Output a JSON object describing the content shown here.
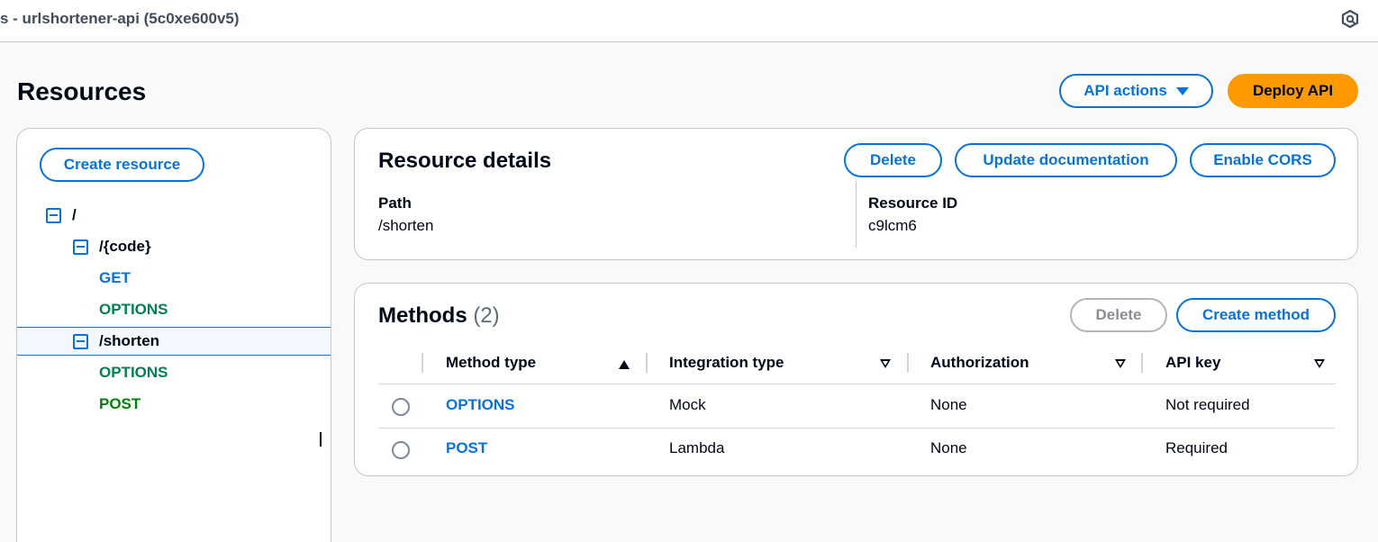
{
  "topbar": {
    "title": "s - urlshortener-api (5c0xe600v5)",
    "icon": "cloudshell-icon"
  },
  "page": {
    "title": "Resources",
    "api_actions_label": "API actions",
    "deploy_api_label": "Deploy API"
  },
  "tree": {
    "create_resource_label": "Create resource",
    "items": [
      {
        "label": "/",
        "kind": "resource"
      },
      {
        "label": "/{code}",
        "kind": "resource"
      },
      {
        "label": "GET",
        "kind": "method"
      },
      {
        "label": "OPTIONS",
        "kind": "method"
      },
      {
        "label": "/shorten",
        "kind": "resource",
        "selected": true
      },
      {
        "label": "OPTIONS",
        "kind": "method"
      },
      {
        "label": "POST",
        "kind": "method"
      }
    ]
  },
  "details": {
    "title": "Resource details",
    "delete_label": "Delete",
    "update_doc_label": "Update documentation",
    "enable_cors_label": "Enable CORS",
    "path_label": "Path",
    "path_value": "/shorten",
    "resource_id_label": "Resource ID",
    "resource_id_value": "c9lcm6"
  },
  "methods": {
    "title": "Methods",
    "count": "(2)",
    "delete_label": "Delete",
    "create_method_label": "Create method",
    "columns": [
      "Method type",
      "Integration type",
      "Authorization",
      "API key"
    ],
    "rows": [
      {
        "method": "OPTIONS",
        "integration": "Mock",
        "authorization": "None",
        "api_key": "Not required"
      },
      {
        "method": "POST",
        "integration": "Lambda",
        "authorization": "None",
        "api_key": "Required"
      }
    ]
  },
  "colors": {
    "accent": "#0972d3",
    "deploy_button": "#ff9900",
    "method_get": "#0972d3",
    "method_options": "#037f51",
    "method_post": "#037f0c"
  }
}
